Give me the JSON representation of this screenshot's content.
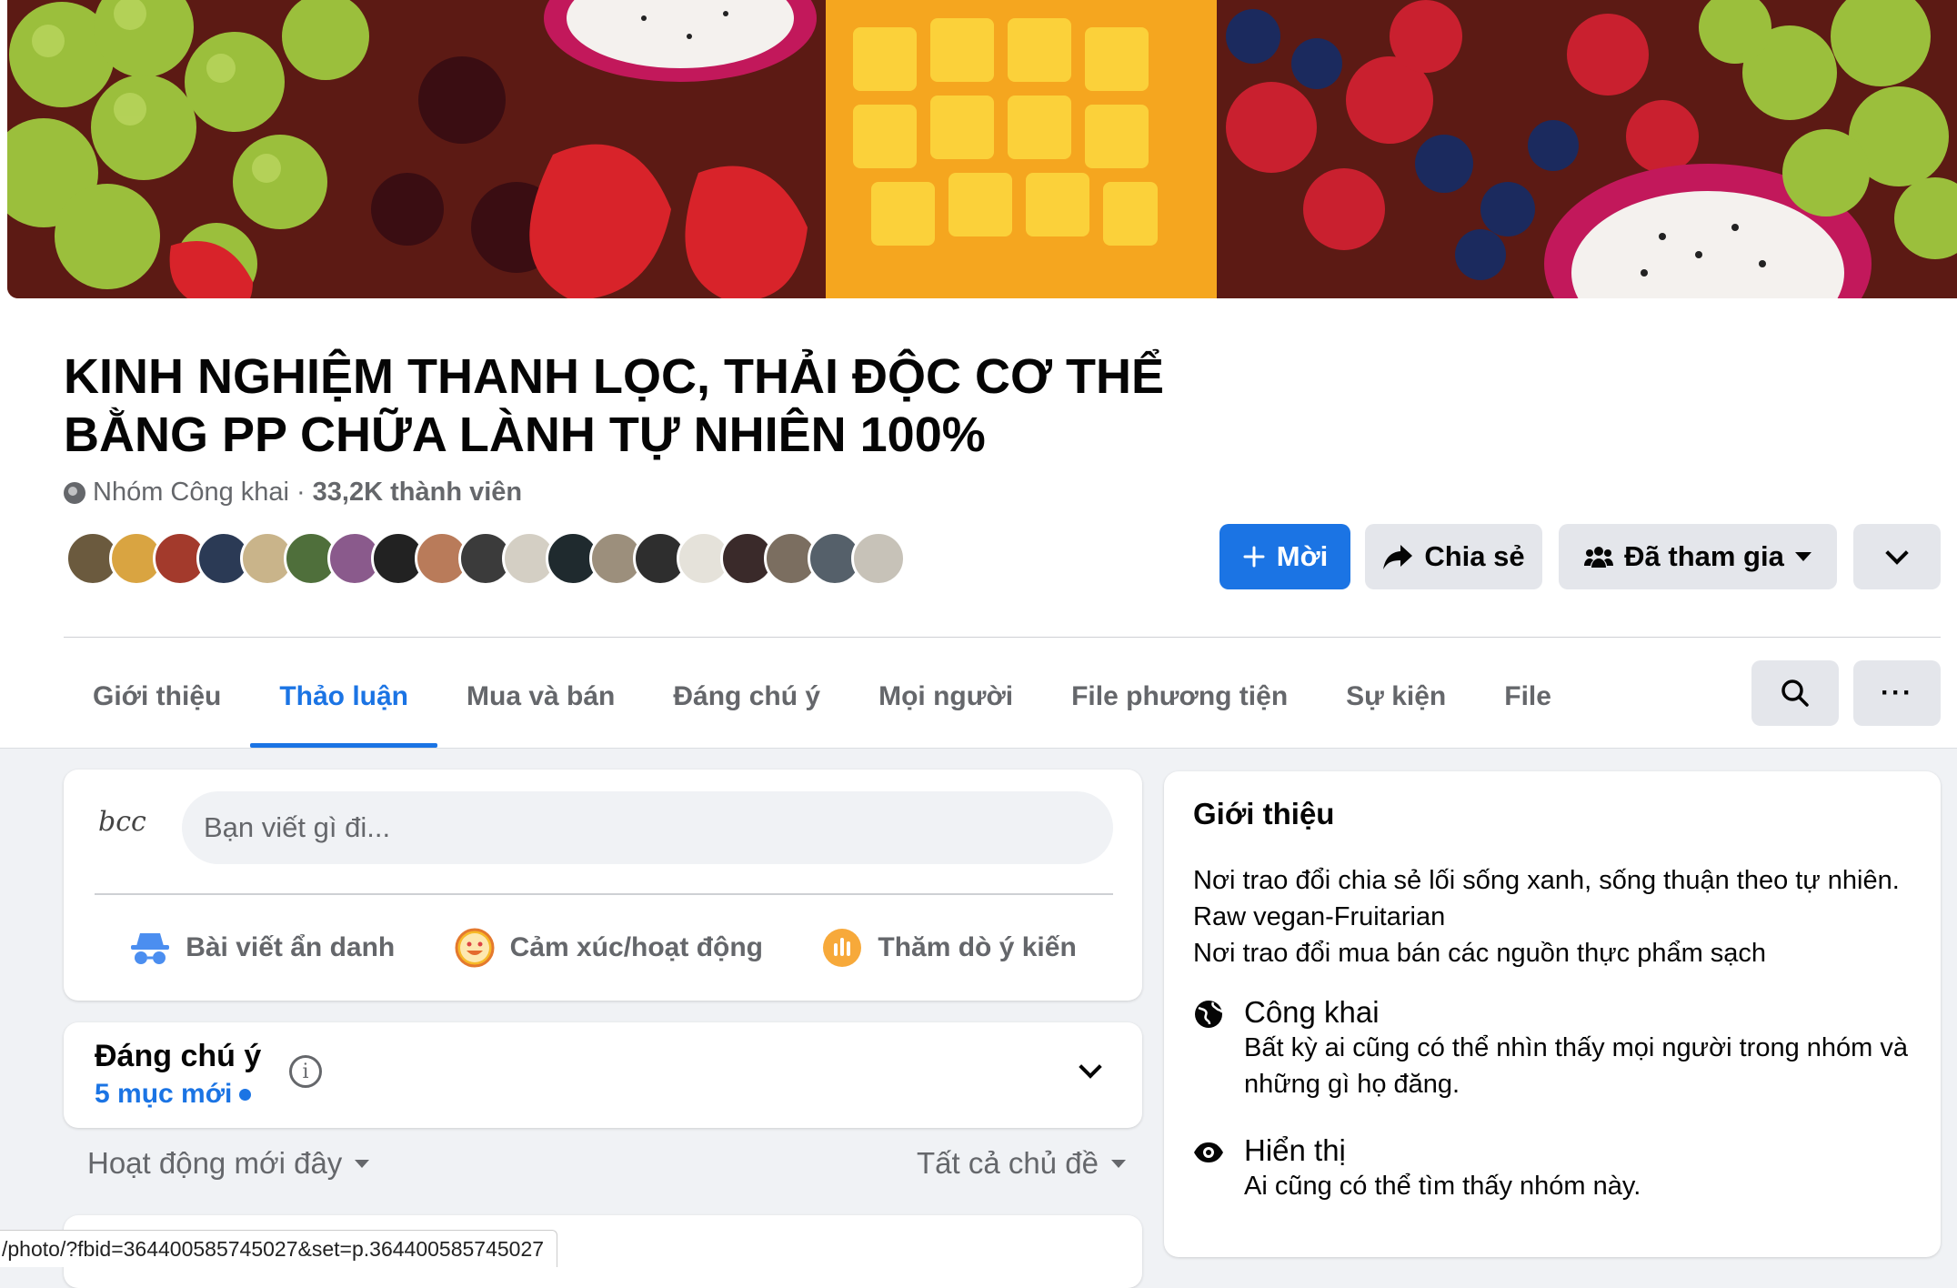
{
  "group": {
    "title": "KINH NGHIỆM THANH LỌC, THẢI ĐỘC CƠ THỂ BẰNG PP CHỮA LÀNH TỰ NHIÊN 100%",
    "privacy": "Nhóm Công khai",
    "separator": "·",
    "members": "33,2K thành viên"
  },
  "actions": {
    "invite": "Mời",
    "share": "Chia sẻ",
    "joined": "Đã tham gia"
  },
  "tabs": [
    {
      "label": "Giới thiệu"
    },
    {
      "label": "Thảo luận",
      "active": true
    },
    {
      "label": "Mua và bán"
    },
    {
      "label": "Đáng chú ý"
    },
    {
      "label": "Mọi người"
    },
    {
      "label": "File phương tiện"
    },
    {
      "label": "Sự kiện"
    },
    {
      "label": "File"
    }
  ],
  "tab_more": "···",
  "composer": {
    "user_logo": "bcc",
    "placeholder": "Bạn viết gì đi...",
    "anonymous": "Bài viết ẩn danh",
    "feeling": "Cảm xúc/hoạt động",
    "poll": "Thăm dò ý kiến"
  },
  "notable": {
    "title": "Đáng chú ý",
    "new_items": "5 mục mới",
    "info": "i"
  },
  "filters": {
    "recent": "Hoạt động mới đây",
    "topics": "Tất cả chủ đề"
  },
  "about": {
    "heading": "Giới thiệu",
    "description": [
      "Nơi trao đổi chia sẻ lối sống xanh, sống thuận theo tự nhiên. Raw vegan-Fruitarian",
      "Nơi trao đổi mua bán các nguồn thực phẩm sạch"
    ],
    "public_title": "Công khai",
    "public_desc": "Bất kỳ ai cũng có thể nhìn thấy mọi người trong nhóm và những gì họ đăng.",
    "visible_title": "Hiển thị",
    "visible_desc": "Ai cũng có thể tìm thấy nhóm này."
  },
  "status_url": "/photo/?fbid=364400585745027&set=p.364400585745027",
  "colors": {
    "accent": "#1b74e4",
    "secondary_text": "#65676b",
    "button_gray": "#e4e6eb",
    "page_bg": "#f0f2f5"
  },
  "icons": {
    "privacy": "globe-icon",
    "invite": "plus-icon",
    "share": "share-arrow-icon",
    "joined": "group-people-icon",
    "anonymous": "incognito-icon",
    "feeling": "smiley-icon",
    "poll": "poll-icon",
    "search": "search-icon",
    "visible": "eye-icon"
  }
}
